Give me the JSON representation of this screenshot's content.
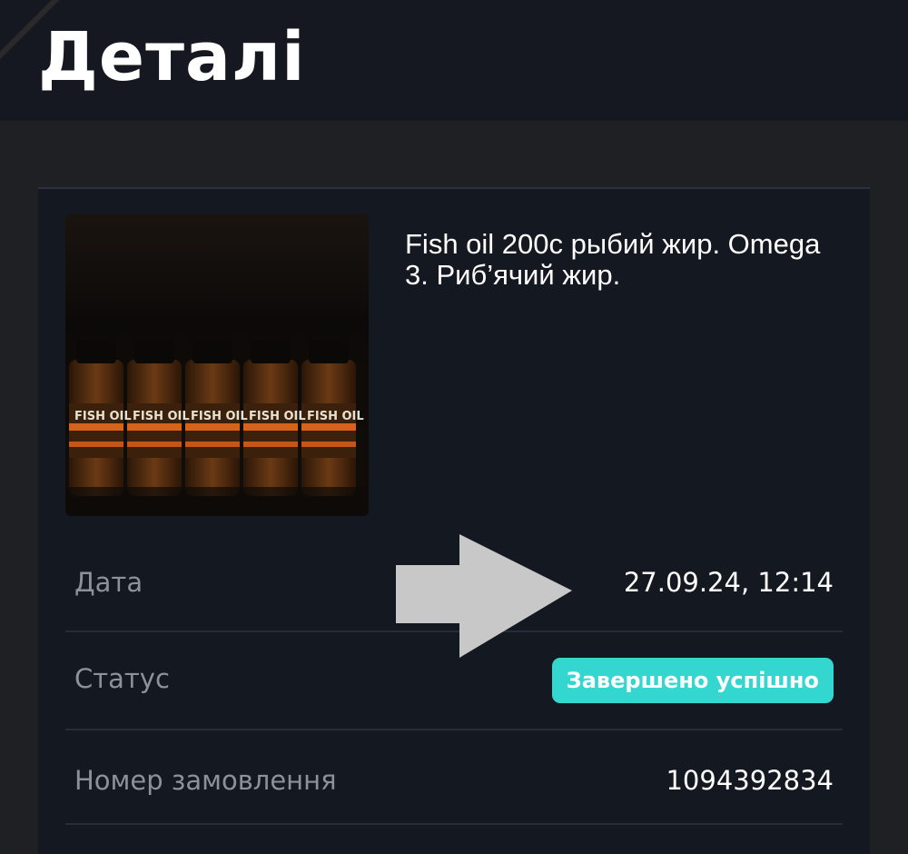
{
  "header": {
    "title": "Деталі"
  },
  "product": {
    "name": "Fish oil 200c рыбий жир. Omega 3. Риб’ячий жир.",
    "image_label": "FISH OIL"
  },
  "details": {
    "date_label": "Дата",
    "date_value": "27.09.24, 12:14",
    "status_label": "Статус",
    "status_value": "Завершено успішно",
    "order_label": "Номер замовлення",
    "order_value": "1094392834"
  },
  "colors": {
    "background": "#1f2024",
    "card": "#141820",
    "status_badge": "#34d6d0",
    "arrow": "#c8c8c8"
  }
}
